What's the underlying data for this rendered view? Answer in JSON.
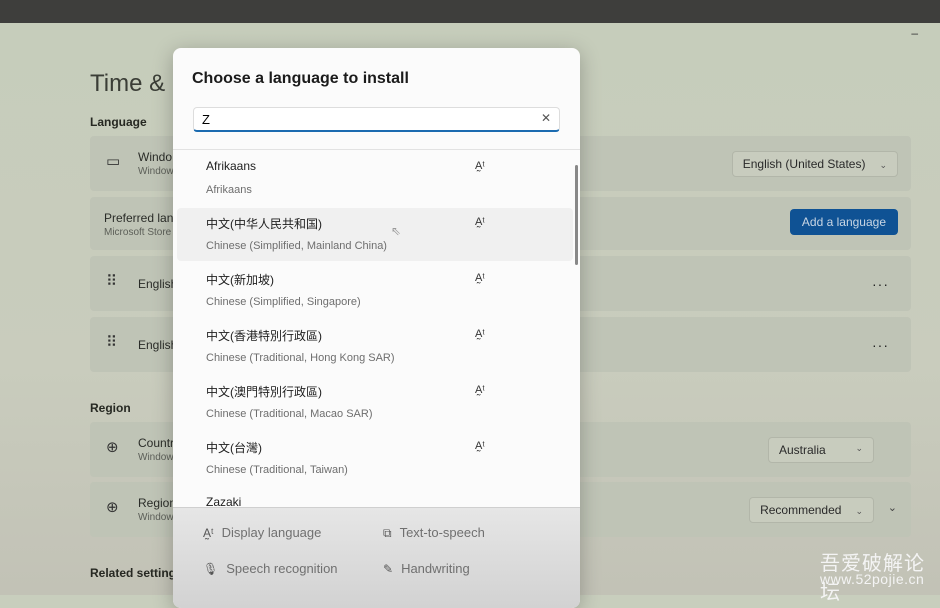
{
  "window": {
    "minimize_icon": "minimize-icon",
    "minimize": "–"
  },
  "settings": {
    "page_title": "Time & l",
    "language_section": "Language",
    "windows_display": {
      "title": "Windo",
      "subtitle": "Window",
      "value": "English (United States)"
    },
    "preferred": {
      "title": "Preferred lang",
      "subtitle": "Microsoft Store",
      "button": "Add a language"
    },
    "languages": [
      {
        "name": "English"
      },
      {
        "name": "English"
      }
    ],
    "region_section": "Region",
    "country": {
      "title": "Countr",
      "subtitle": "Window",
      "value": "Australia"
    },
    "regional_format": {
      "title": "Region",
      "subtitle": "Window",
      "value": "Recommended"
    },
    "related": "Related settings"
  },
  "dialog": {
    "title": "Choose a language to install",
    "search_value": "Z",
    "items": [
      {
        "name": "Afrikaans",
        "desc": "Afrikaans"
      },
      {
        "name": "中文(中华人民共和国)",
        "desc": "Chinese (Simplified, Mainland China)"
      },
      {
        "name": "中文(新加坡)",
        "desc": "Chinese (Simplified, Singapore)"
      },
      {
        "name": "中文(香港特別行政區)",
        "desc": "Chinese (Traditional, Hong Kong SAR)"
      },
      {
        "name": "中文(澳門特別行政區)",
        "desc": "Chinese (Traditional, Macao SAR)"
      },
      {
        "name": "中文(台灣)",
        "desc": "Chinese (Traditional, Taiwan)"
      },
      {
        "name": "Zazaki",
        "desc": ""
      }
    ],
    "features": {
      "display": "Display language",
      "tts": "Text-to-speech",
      "speech": "Speech recognition",
      "handwriting": "Handwriting"
    }
  },
  "watermark": {
    "line1": "吾爱破解论坛",
    "line2": "www.52pojie.cn"
  },
  "colors": {
    "accent": "#0f5294",
    "focus": "#1b6bb0"
  }
}
